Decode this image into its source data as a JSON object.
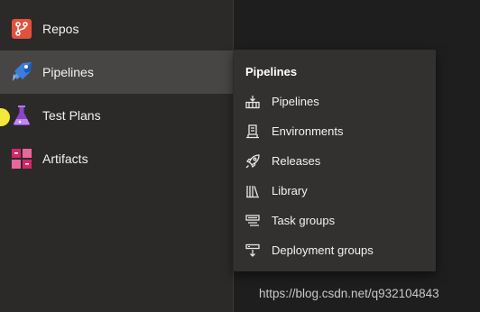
{
  "nav": {
    "items": [
      {
        "label": "Repos",
        "icon": "repos-icon"
      },
      {
        "label": "Pipelines",
        "icon": "pipelines-icon",
        "selected": true
      },
      {
        "label": "Test Plans",
        "icon": "test-plans-icon"
      },
      {
        "label": "Artifacts",
        "icon": "artifacts-icon"
      }
    ]
  },
  "flyout": {
    "title": "Pipelines",
    "items": [
      {
        "label": "Pipelines",
        "icon": "pipelines-sub-icon"
      },
      {
        "label": "Environments",
        "icon": "environments-icon"
      },
      {
        "label": "Releases",
        "icon": "rocket-icon"
      },
      {
        "label": "Library",
        "icon": "library-icon"
      },
      {
        "label": "Task groups",
        "icon": "task-groups-icon"
      },
      {
        "label": "Deployment groups",
        "icon": "deployment-groups-icon"
      }
    ]
  },
  "colors": {
    "repos": "#e2513b",
    "pipelines": "#3b7ddd",
    "test_plans": "#8b46c8",
    "artifacts": "#d4266d",
    "cursor": "#f2e83a"
  },
  "watermark": "https://blog.csdn.net/q932104843"
}
